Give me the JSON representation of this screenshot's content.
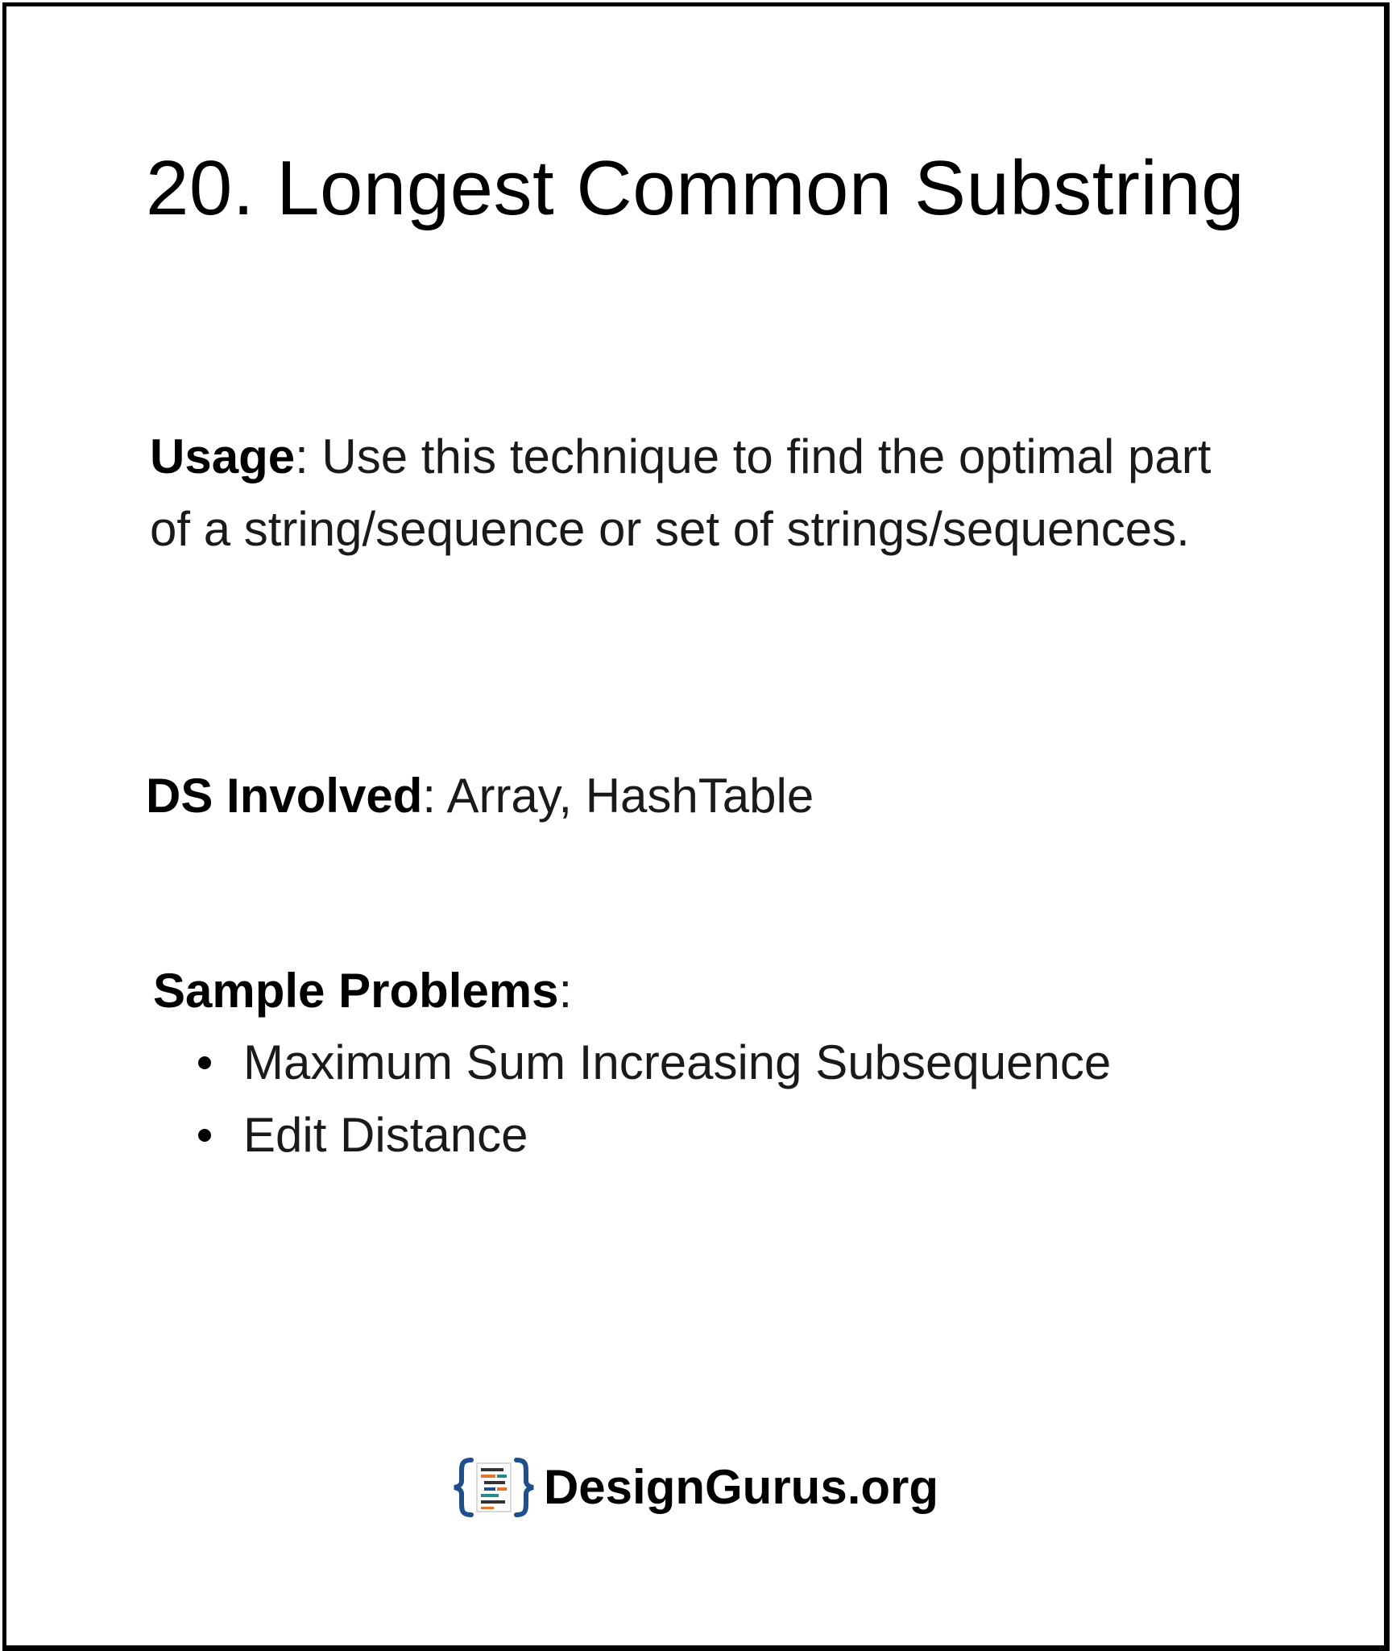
{
  "title": "20. Longest Common Substring",
  "usage": {
    "label": "Usage",
    "text": ": Use this technique to find the optimal part of a string/sequence or set of strings/sequences."
  },
  "ds_involved": {
    "label": "DS Involved",
    "text": ": Array, HashTable"
  },
  "sample_problems": {
    "label": "Sample Problems",
    "suffix": ":",
    "items": [
      "Maximum Sum Increasing Subsequence",
      "Edit Distance"
    ]
  },
  "brand": {
    "name": "DesignGurus.org",
    "logo_icon": "code-braces-logo-icon",
    "brace_color": "#1f4e8c",
    "line_colors": [
      "#333333",
      "#e8742c",
      "#2a8a8a",
      "#1f4e8c"
    ]
  }
}
